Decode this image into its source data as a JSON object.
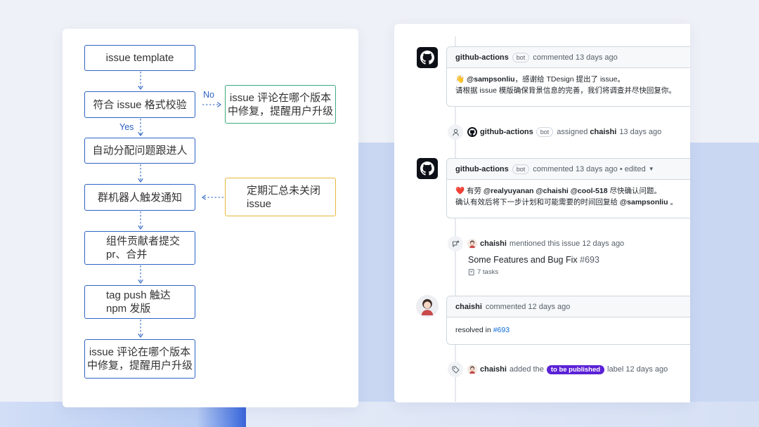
{
  "colors": {
    "flow_border_blue": "#2f64c4",
    "flow_border_green": "#3caa7e",
    "flow_border_yellow": "#e7b83b",
    "edge_label_blue": "#2e62c6",
    "label_purple": "#5b21d6",
    "link_blue": "#0969da"
  },
  "flow": {
    "nodes": [
      {
        "id": "n1",
        "text": "issue template"
      },
      {
        "id": "n2",
        "text": "符合 issue 格式校验"
      },
      {
        "id": "n3",
        "text": "自动分配问题跟进人"
      },
      {
        "id": "n4",
        "text": "群机器人触发通知"
      },
      {
        "id": "n5",
        "text": "组件贡献者提交\npr、合并"
      },
      {
        "id": "n6",
        "text": "tag push 触达\nnpm 发版"
      },
      {
        "id": "n7",
        "text": "issue 评论在哪个版本\n中修复，提醒用户升级"
      },
      {
        "id": "s1",
        "text": "issue 评论在哪个版本\n中修复，提醒用户升级"
      },
      {
        "id": "s2",
        "text": "定期汇总未关闭\nissue"
      }
    ],
    "edge_labels": {
      "no": "No",
      "yes": "Yes"
    }
  },
  "timeline": {
    "comment1": {
      "author": "github-actions",
      "badge": "bot",
      "meta": "commented 13 days ago",
      "emoji": "👋",
      "mention": "@sampsonliu",
      "line1_rest": "，感谢给 TDesign 提出了 issue。",
      "line2": "请根据 issue 模版确保背景信息的完善，我们将调查并尽快回复你。"
    },
    "event_assigned": {
      "actor": "github-actions",
      "badge": "bot",
      "verb": "assigned",
      "target": "chaishi",
      "time": "13 days ago"
    },
    "comment2": {
      "author": "github-actions",
      "badge": "bot",
      "meta": "commented 13 days ago • edited",
      "emoji": "❤️",
      "line1_prefix": "有劳",
      "mentions": "@realyuyanan @chaishi @cool-518",
      "line1_rest": "尽快确认问题。",
      "line2_prefix": "确认有效后将下一步计划和可能需要的时间回复给",
      "line2_mention": "@sampsonliu",
      "line2_end": "。"
    },
    "event_mentioned": {
      "actor": "chaishi",
      "text": "mentioned this issue 12 days ago",
      "ref_title": "Some Features and Bug Fix",
      "ref_num": "#693",
      "tasks": "7 tasks"
    },
    "comment3": {
      "author": "chaishi",
      "meta": "commented 12 days ago",
      "body_prefix": "resolved in",
      "body_link": "#693"
    },
    "event_labeled": {
      "actor": "chaishi",
      "verb": "added the",
      "label": "to be published",
      "suffix": "label 12 days ago"
    }
  }
}
